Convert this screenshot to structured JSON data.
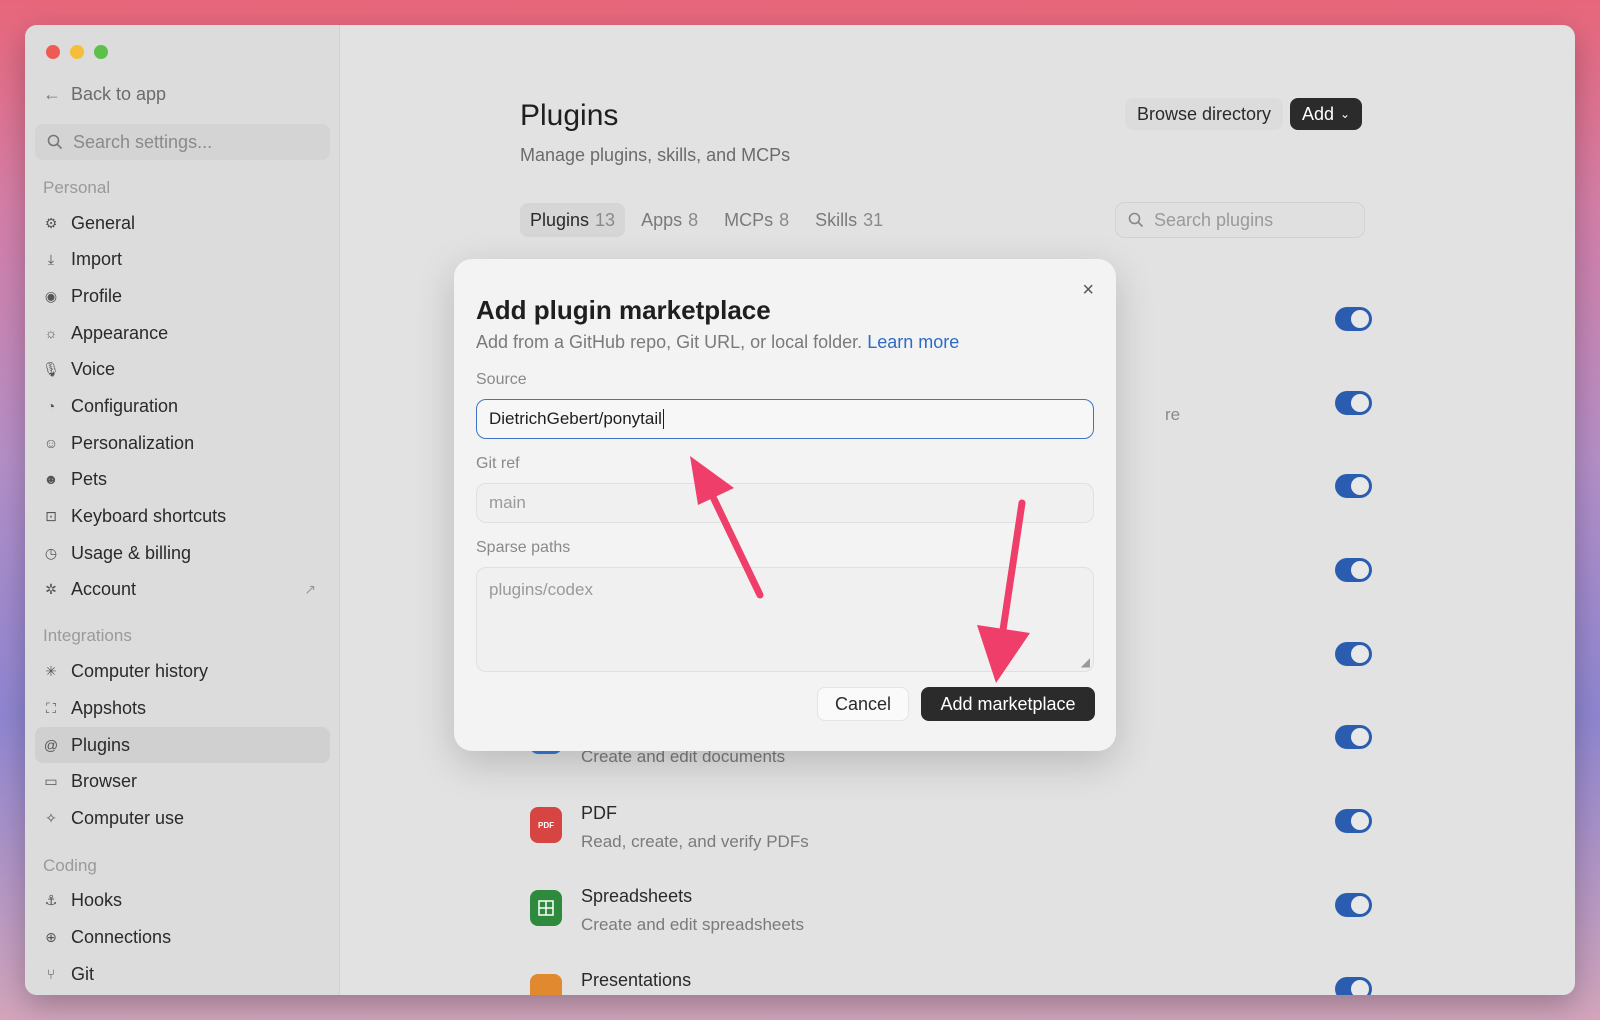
{
  "sidebar": {
    "back_label": "Back to app",
    "search_placeholder": "Search settings...",
    "sections": {
      "personal": "Personal",
      "integrations": "Integrations",
      "coding": "Coding"
    },
    "personal_items": [
      {
        "label": "General",
        "icon": "gear-icon"
      },
      {
        "label": "Import",
        "icon": "download-icon"
      },
      {
        "label": "Profile",
        "icon": "user-circle-icon"
      },
      {
        "label": "Appearance",
        "icon": "sun-icon"
      },
      {
        "label": "Voice",
        "icon": "microphone-icon"
      },
      {
        "label": "Configuration",
        "icon": "sliders-icon"
      },
      {
        "label": "Personalization",
        "icon": "smile-icon"
      },
      {
        "label": "Pets",
        "icon": "paw-icon"
      },
      {
        "label": "Keyboard shortcuts",
        "icon": "keyboard-icon"
      },
      {
        "label": "Usage & billing",
        "icon": "gauge-icon"
      },
      {
        "label": "Account",
        "icon": "openai-icon"
      }
    ],
    "integration_items": [
      {
        "label": "Computer history",
        "icon": "sparkle-icon"
      },
      {
        "label": "Appshots",
        "icon": "capture-icon"
      },
      {
        "label": "Plugins",
        "icon": "at-icon"
      },
      {
        "label": "Browser",
        "icon": "browser-icon"
      },
      {
        "label": "Computer use",
        "icon": "cursor-sparkle-icon"
      }
    ],
    "coding_items": [
      {
        "label": "Hooks",
        "icon": "anchor-icon"
      },
      {
        "label": "Connections",
        "icon": "globe-icon"
      },
      {
        "label": "Git",
        "icon": "git-icon"
      }
    ]
  },
  "main": {
    "title": "Plugins",
    "subtitle": "Manage plugins, skills, and MCPs",
    "browse_label": "Browse directory",
    "add_label": "Add",
    "tabs": [
      {
        "label": "Plugins",
        "count": "13"
      },
      {
        "label": "Apps",
        "count": "8"
      },
      {
        "label": "MCPs",
        "count": "8"
      },
      {
        "label": "Skills",
        "count": "31"
      }
    ],
    "search_placeholder": "Search plugins",
    "partial_text": "re",
    "plugins": [
      {
        "name": "",
        "desc": "Create and edit documents"
      },
      {
        "name": "PDF",
        "desc": "Read, create, and verify PDFs",
        "icon_text": "PDF"
      },
      {
        "name": "Spreadsheets",
        "desc": "Create and edit spreadsheets"
      },
      {
        "name": "Presentations",
        "desc": ""
      }
    ]
  },
  "modal": {
    "title": "Add plugin marketplace",
    "description": "Add from a GitHub repo, Git URL, or local folder.",
    "learn_more": "Learn more",
    "source_label": "Source",
    "source_value": "DietrichGebert/ponytail",
    "gitref_label": "Git ref",
    "gitref_placeholder": "main",
    "sparse_label": "Sparse paths",
    "sparse_placeholder": "plugins/codex",
    "cancel_label": "Cancel",
    "submit_label": "Add marketplace"
  },
  "colors": {
    "accent": "#2a5db0",
    "link": "#2d6bc4",
    "annotation_arrow": "#ee3e69"
  }
}
